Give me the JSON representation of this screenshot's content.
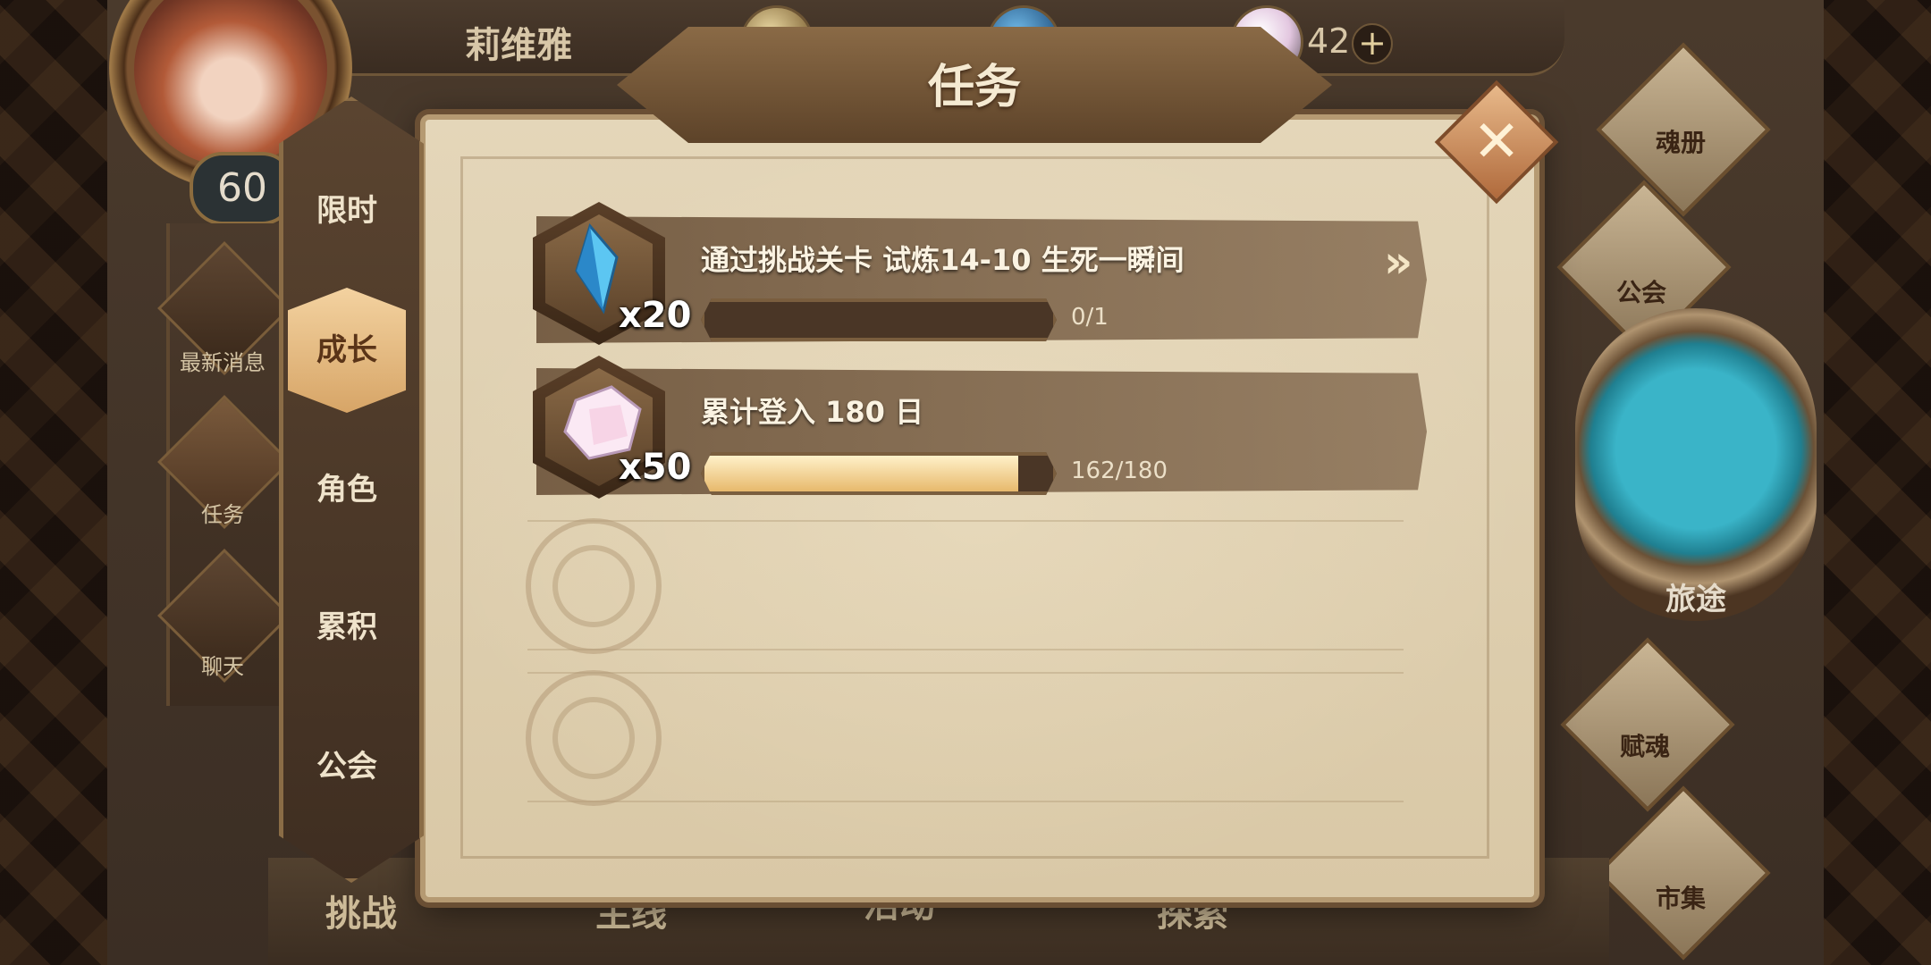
{
  "player": {
    "name": "莉维雅",
    "level": "60"
  },
  "currencies": {
    "gold": "",
    "crystal": "",
    "gem": "42"
  },
  "left_menu": [
    {
      "label": "最新消息",
      "icon": "scroll-icon"
    },
    {
      "label": "任务",
      "icon": "quest-badge-icon"
    },
    {
      "label": "聊天",
      "icon": "chat-icon"
    }
  ],
  "right_menu": [
    {
      "label": "魂册",
      "icon": "soul-book-icon"
    },
    {
      "label": "公会",
      "icon": "guild-banner-icon"
    },
    {
      "label": "旅途",
      "icon": "journey-emblem-icon"
    },
    {
      "label": "赋魂",
      "icon": "soul-flame-icon"
    },
    {
      "label": "市集",
      "icon": "market-crystal-icon"
    }
  ],
  "bottom_nav": [
    "挑战",
    "主线",
    "活动",
    "探索"
  ],
  "dialog": {
    "title": "任务",
    "tabs": [
      {
        "label": "限时",
        "active": false
      },
      {
        "label": "成长",
        "active": true
      },
      {
        "label": "角色",
        "active": false
      },
      {
        "label": "累积",
        "active": false
      },
      {
        "label": "公会",
        "active": false
      }
    ],
    "tasks": [
      {
        "reward_icon": "blue-crystal-icon",
        "reward_qty": "x20",
        "title": "通过挑战关卡 试炼14-10 生死一瞬间",
        "progress_text": "0/1",
        "progress": 0
      },
      {
        "reward_icon": "rainbow-gem-icon",
        "reward_qty": "x50",
        "title": "累计登入 180 日",
        "progress_text": "162/180",
        "progress": 0.9
      }
    ]
  },
  "colors": {
    "parchment": "#dccbaa",
    "row_brown": "#7a5e42",
    "bar_fill": "#f0c77e",
    "journey_teal": "#2fa7bb"
  }
}
